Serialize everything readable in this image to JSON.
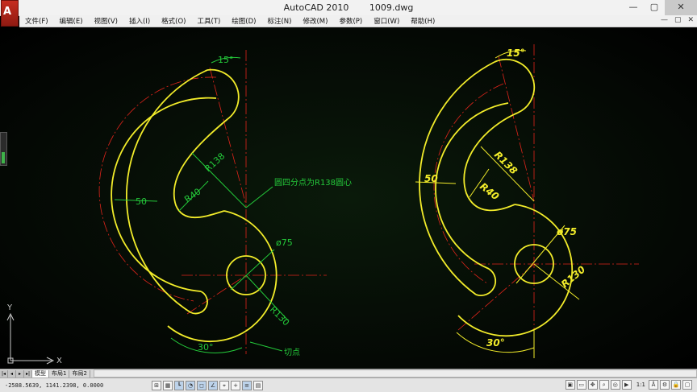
{
  "window": {
    "app_title": "AutoCAD 2010",
    "file_name": "1009.dwg",
    "logo_glyph": "A",
    "controls": [
      "—",
      "▢",
      "✕"
    ]
  },
  "menu": [
    "文件(F)",
    "编辑(E)",
    "视图(V)",
    "插入(I)",
    "格式(O)",
    "工具(T)",
    "绘图(D)",
    "标注(N)",
    "修改(M)",
    "参数(P)",
    "窗口(W)",
    "帮助(H)"
  ],
  "menu_right": [
    "—",
    "▢",
    "✕"
  ],
  "drawing": {
    "left": {
      "angle_top": "15°",
      "angle_bottom": "30°",
      "r138": "R138",
      "r40": "R40",
      "width50": "50",
      "dia75": "ø75",
      "r130": "R130",
      "note": "圆四分点为R138圆心",
      "tangent_note": "切点"
    },
    "right": {
      "angle_top": "15°",
      "angle_bottom": "30°",
      "r138": "R138",
      "r40": "R40",
      "width50": "50",
      "dia75": "ø75",
      "r130": "R130"
    },
    "ucs": {
      "x": "X",
      "y": "Y"
    }
  },
  "tabs": [
    "模型",
    "布局1",
    "布局2"
  ],
  "status": {
    "coords": "-2588.5639, 1141.2398, 0.0000",
    "scale": "1:1"
  },
  "colors": {
    "geometry": "#f2ec2a",
    "dimension": "#24c93a",
    "centerline": "#e0241b",
    "background": "#000000"
  }
}
